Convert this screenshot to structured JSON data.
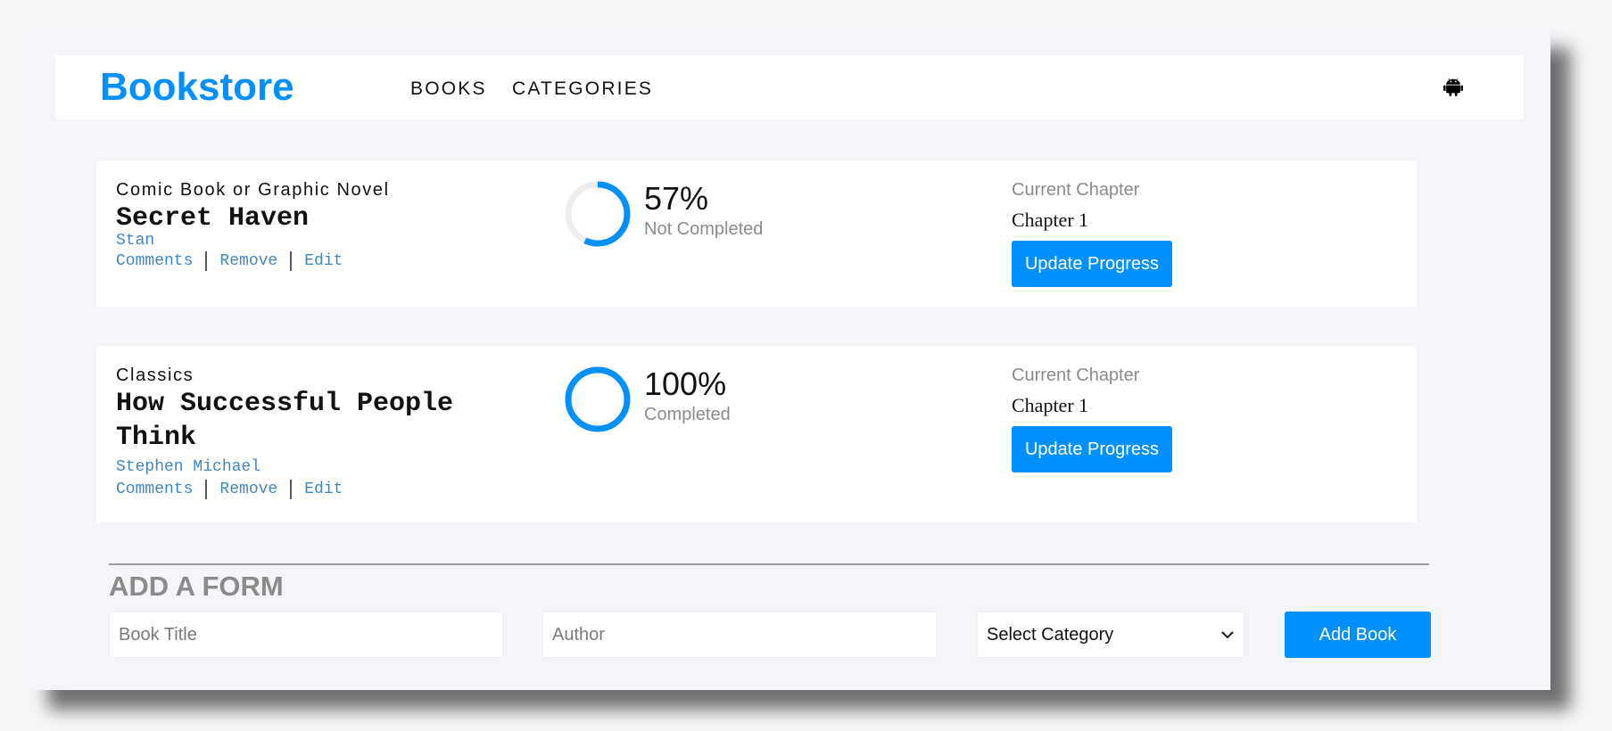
{
  "brand": {
    "logo": "Bookstore",
    "accent": "#0290ff"
  },
  "nav": {
    "books": "BOOKS",
    "categories": "CATEGORIES",
    "user_icon": "user-icon"
  },
  "books": [
    {
      "genre": "Comic Book or Graphic Novel",
      "title": "Secret Haven",
      "author": "Stan",
      "actions": {
        "comments": "Comments",
        "remove": "Remove",
        "edit": "Edit"
      },
      "progress_percent": 57,
      "progress_label": "57%",
      "status": "Not Completed",
      "chapter_label": "Current Chapter",
      "chapter": "Chapter 1",
      "update_label": "Update Progress"
    },
    {
      "genre": "Classics",
      "title": "How Successful People Think",
      "author": "Stephen Michael",
      "actions": {
        "comments": "Comments",
        "remove": "Remove",
        "edit": "Edit"
      },
      "progress_percent": 100,
      "progress_label": "100%",
      "status": "Completed",
      "chapter_label": "Current Chapter",
      "chapter": "Chapter 1",
      "update_label": "Update Progress"
    }
  ],
  "form": {
    "heading": "ADD A FORM",
    "title_placeholder": "Book Title",
    "author_placeholder": "Author",
    "category_selected": "Select Category",
    "submit_label": "Add Book"
  }
}
